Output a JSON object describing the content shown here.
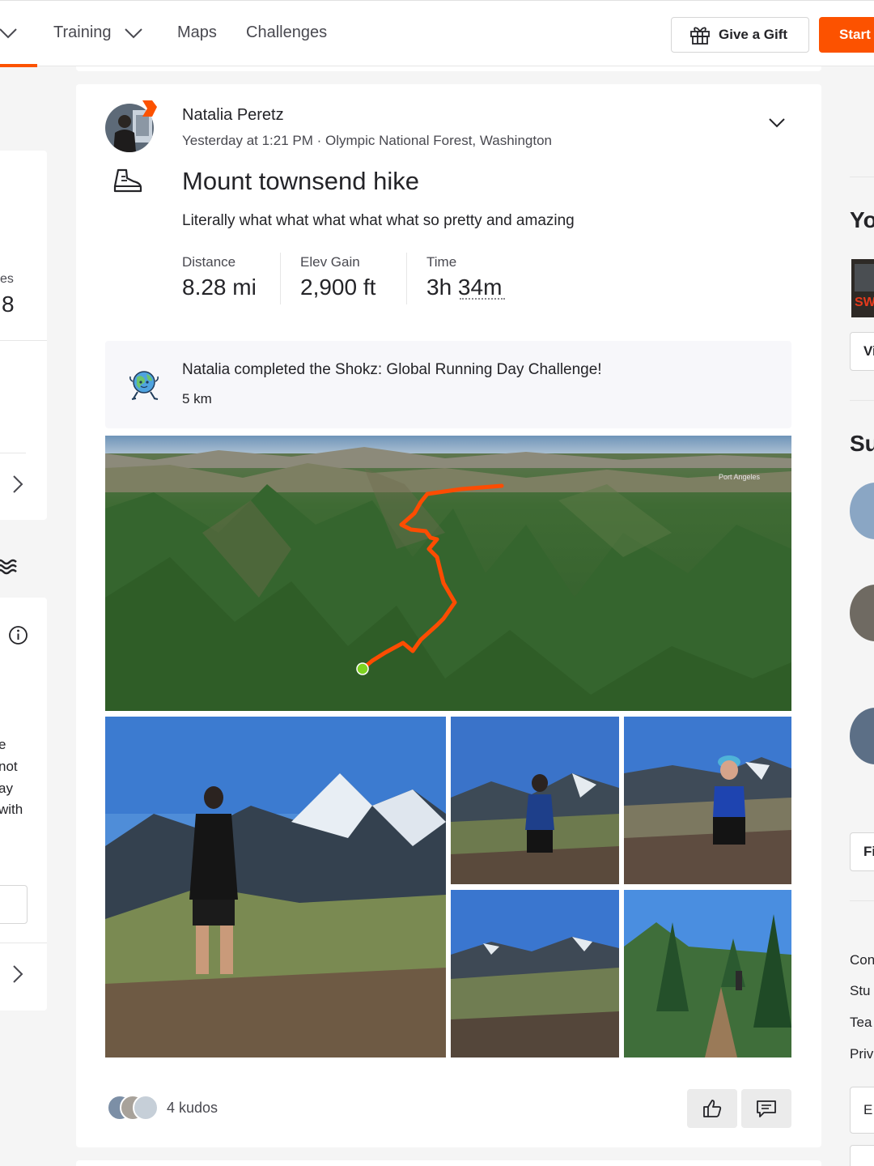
{
  "nav": {
    "training": "Training",
    "maps": "Maps",
    "challenges": "Challenges",
    "gift_button": "Give a Gift",
    "start_button": "Start"
  },
  "left_column": {
    "stat_label_fragment": "es",
    "stat_value_fragment": "8",
    "text_fragments": [
      "e",
      "not",
      "ay",
      "with"
    ]
  },
  "activity": {
    "athlete_name": "Natalia Peretz",
    "meta": "Yesterday at 1:21 PM · Olympic National Forest, Washington",
    "title": "Mount townsend hike",
    "description": "Literally what what what what what so pretty and amazing",
    "stats": [
      {
        "label": "Distance",
        "value": "8.28 mi"
      },
      {
        "label": "Elev Gain",
        "value": "2,900 ft"
      },
      {
        "label": "Time",
        "value": "3h 34m"
      }
    ],
    "challenge": {
      "text": "Natalia completed the Shokz: Global Running Day Challenge!",
      "sub": "5 km"
    },
    "map_label": "Port Angeles",
    "kudos": "4 kudos"
  },
  "right_column": {
    "heading_1": "Yo",
    "button_1": "Vi",
    "heading_2": "Su",
    "button_2": "Fi",
    "links": [
      "Con",
      "Stu",
      "Tea",
      "Priv"
    ],
    "button_3": "E"
  },
  "colors": {
    "brand": "#fc5200",
    "route": "#fc4c02",
    "route_start": "#7ed321"
  }
}
